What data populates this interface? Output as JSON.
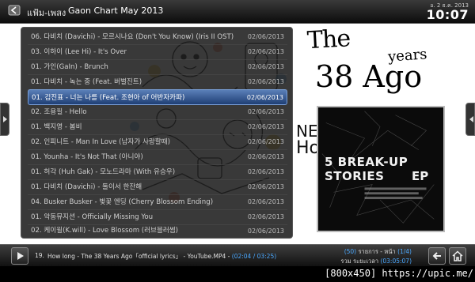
{
  "header": {
    "breadcrumb_root": "แฟ้ม-เพลง",
    "separator": "-",
    "breadcrumb_current": "Gaon Chart May 2013",
    "date": "อ. 2 ธ.ค. 2013",
    "clock": "10:07"
  },
  "background": {
    "line1": "The",
    "line1b": "years",
    "line2": "38 Ago",
    "side_line1": "NE",
    "side_line2": "Ho"
  },
  "playlist": {
    "rows": [
      {
        "label": "06. 다비치 (Davichi) - 모르시나요 (Don't You Know) (Iris II OST)",
        "date": "02/06/2013"
      },
      {
        "label": "03. 이하이 (Lee Hi) - It's Over",
        "date": "02/06/2013"
      },
      {
        "label": "01. 가인(GaIn) - Brunch",
        "date": "02/06/2013"
      },
      {
        "label": "01. 다비치 - 녹는 중 (Feat. 버벌진트)",
        "date": "02/06/2013"
      },
      {
        "label": "01. 김진표 - 너는 나를 (Feat. 조현아 of 어반자카파)",
        "date": "02/06/2013"
      },
      {
        "label": "02. 조용필 - Hello",
        "date": "02/06/2013"
      },
      {
        "label": "01. 백지영 - 봄비",
        "date": "02/06/2013"
      },
      {
        "label": "02. 인피니트 - Man In Love (남자가 사랑할때)",
        "date": "02/06/2013"
      },
      {
        "label": "01. Younha - It's Not That (아니야)",
        "date": "02/06/2013"
      },
      {
        "label": "01. 허각 (Huh Gak) - 모노드라마 (With 유승우)",
        "date": "02/06/2013"
      },
      {
        "label": "01. 다비치 (Davichi) - 둘이서 한잔해",
        "date": "02/06/2013"
      },
      {
        "label": "04. Busker Busker - 벚꽃 엔딩 (Cherry Blossom Ending)",
        "date": "02/06/2013"
      },
      {
        "label": "01. 악동뮤지션 - Officially Missing You",
        "date": "02/06/2013"
      },
      {
        "label": "02. 케이윌(K.will) - Love Blossom (러브블러썸)",
        "date": "02/06/2013"
      }
    ],
    "selected_index": 4
  },
  "cover": {
    "line1": "5 BREAK-UP",
    "line2": "STORIES",
    "line2b": "EP"
  },
  "now_playing": {
    "number": "19.",
    "title": "How long - The 38 Years Ago「official lyrics」 - YouTube.MP4 -",
    "time": "(02:04 / 03:25)"
  },
  "status": {
    "count_pre": "(50)",
    "count_mid": "รายการ - หน้า",
    "count_page": "(1/4)",
    "total_label": "รวม ระยะเวลา",
    "total_time": "(03:05:07)"
  },
  "watermark": "[800x450] https://upic.me/",
  "colors": {
    "accent_blue": "#4aa8ff",
    "selection": "#3a5f9a"
  },
  "icons": [
    "back-arrow-icon",
    "play-icon",
    "left-arrow-icon",
    "home-icon",
    "scroll-left-icon",
    "scroll-right-icon"
  ]
}
